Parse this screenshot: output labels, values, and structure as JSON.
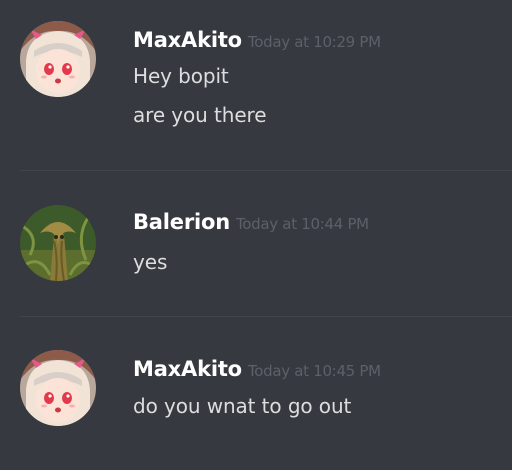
{
  "messages": [
    {
      "username": "MaxAkito",
      "timestamp": "Today at 10:29 PM",
      "avatar": "anime-girl-avatar",
      "lines": [
        "Hey bopit",
        "are you there"
      ]
    },
    {
      "username": "Balerion",
      "timestamp": "Today at 10:44 PM",
      "avatar": "tree-creature-avatar",
      "lines": [
        "yes"
      ]
    },
    {
      "username": "MaxAkito",
      "timestamp": "Today at 10:45 PM",
      "avatar": "anime-girl-avatar",
      "lines": [
        "do you wnat to go out"
      ]
    }
  ],
  "colors": {
    "background": "#36393f",
    "username": "#ffffff",
    "message_text": "#dcddde",
    "timestamp": "#5c6068",
    "divider": "#42454b"
  }
}
